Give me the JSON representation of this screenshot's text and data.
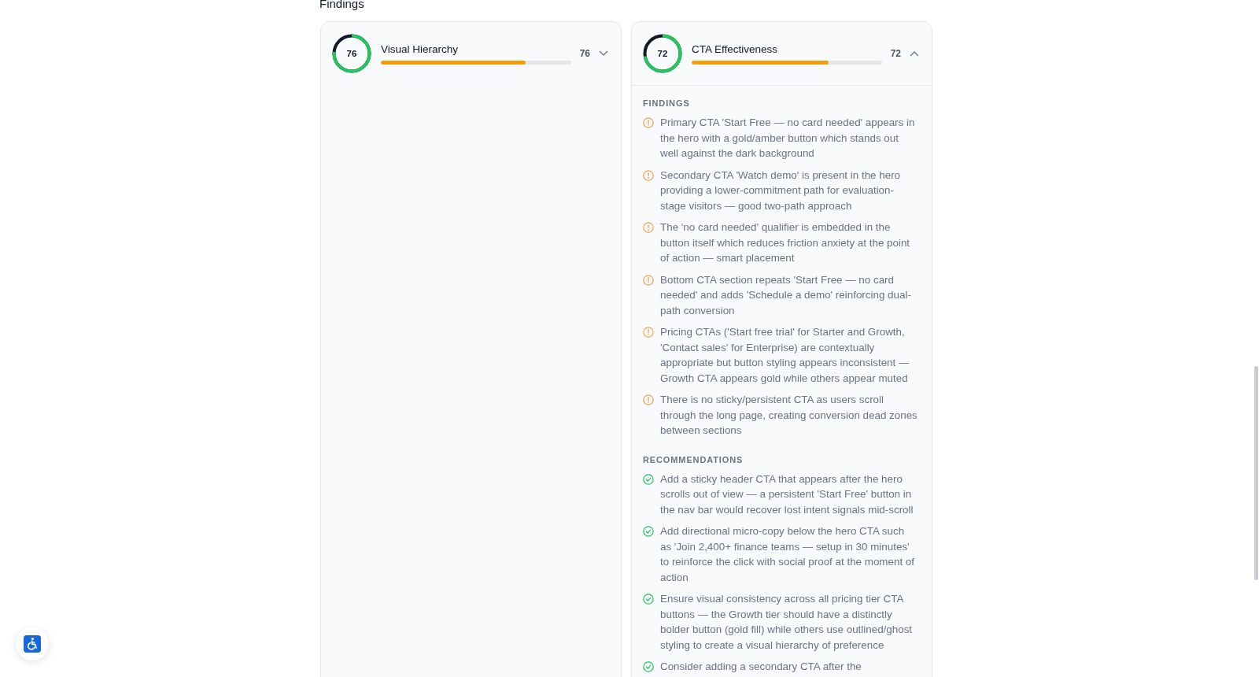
{
  "section_title": "Findings",
  "categories": [
    {
      "title": "Visual Hierarchy",
      "ring_label": "76",
      "score": "76",
      "level": 0.76,
      "expanded": false
    },
    {
      "title": "CTA Effectiveness",
      "ring_label": "72",
      "score": "72",
      "level": 0.72,
      "expanded": true,
      "sections": [
        {
          "kind": "findings",
          "heading": "FINDINGS",
          "items": [
            "Primary CTA 'Start Free — no card needed' appears in the hero with a gold/amber button which stands out well against the dark background",
            "Secondary CTA 'Watch demo' is present in the hero providing a lower-commitment path for evaluation-stage visitors — good two-path approach",
            "The 'no card needed' qualifier is embedded in the button itself which reduces friction anxiety at the point of action — smart placement",
            "Bottom CTA section repeats 'Start Free — no card needed' and adds 'Schedule a demo' reinforcing dual-path conversion",
            "Pricing CTAs ('Start free trial' for Starter and Growth, 'Contact sales' for Enterprise) are contextually appropriate but button styling appears inconsistent — Growth CTA appears gold while others appear muted",
            "There is no sticky/persistent CTA as users scroll through the long page, creating conversion dead zones between sections"
          ]
        },
        {
          "kind": "recommendations",
          "heading": "RECOMMENDATIONS",
          "items": [
            "Add a sticky header CTA that appears after the hero scrolls out of view — a persistent 'Start Free' button in the nav bar would recover lost intent signals mid-scroll",
            "Add directional micro-copy below the hero CTA such as 'Join 2,400+ finance teams — setup in 30 minutes' to reinforce the click with social proof at the moment of action",
            "Ensure visual consistency across all pricing tier CTA buttons — the Growth tier should have a distinctly bolder button (gold fill) while others use outlined/ghost styling to create a visual hierarchy of preference",
            "Consider adding a secondary CTA after the"
          ]
        }
      ]
    }
  ]
}
